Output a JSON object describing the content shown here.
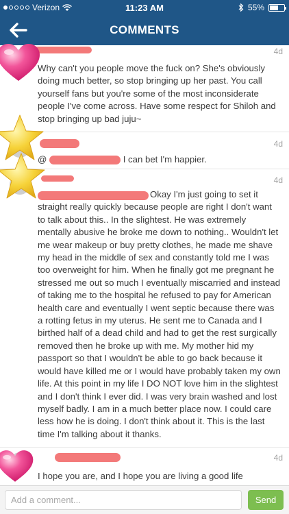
{
  "status_bar": {
    "carrier": "Verizon",
    "time": "11:23 AM",
    "battery_text": "55%",
    "battery_level": 0.55
  },
  "header": {
    "title": "COMMENTS",
    "back_icon": "back-arrow-icon"
  },
  "comments": [
    {
      "age": "4d",
      "text": "Why can't you people move the fuck on? She's obviously doing much better, so stop bringing up her past. You call yourself fans but you're some of the most inconsiderate people I've come across. Have some respect for Shiloh and stop bringing up bad juju~"
    },
    {
      "age": "4d",
      "mention_prefix": "@",
      "text": "I can bet I'm happier."
    },
    {
      "age": "4d",
      "text": "Okay I'm just going to set it straight really quickly because people are right I don't want to talk about this.. In the slightest. He was extremely mentally abusive he broke me down to nothing.. Wouldn't let me wear makeup or buy pretty clothes, he made me shave my head in the middle of sex and constantly told me I was too overweight for him. When he finally got me pregnant he stressed me out so much I eventually miscarried and instead of taking me to the hospital he refused to pay for American health care and eventually I went septic because there was a rotting fetus in my uterus. He sent me to Canada and I birthed half of a dead child and had to get the rest surgically removed then he broke up with me. My mother hid my passport so that I wouldn't be able to go back because it would have killed me or I would have probably taken my own life. At this point in my life I DO NOT love him in the slightest and I don't think I ever did. I was very brain washed and lost myself badly. I am in a much better place now. I could care less how he is doing. I don't think about it. This is the last time I'm talking about it thanks."
    },
    {
      "age": "4d",
      "text": "I hope you are, and I hope you are living a good life"
    }
  ],
  "composer": {
    "placeholder": "Add a comment...",
    "send_label": "Send"
  },
  "colors": {
    "header_bg": "#1f5687",
    "send_bg": "#7dbe50",
    "redaction": "#f26e6e"
  }
}
